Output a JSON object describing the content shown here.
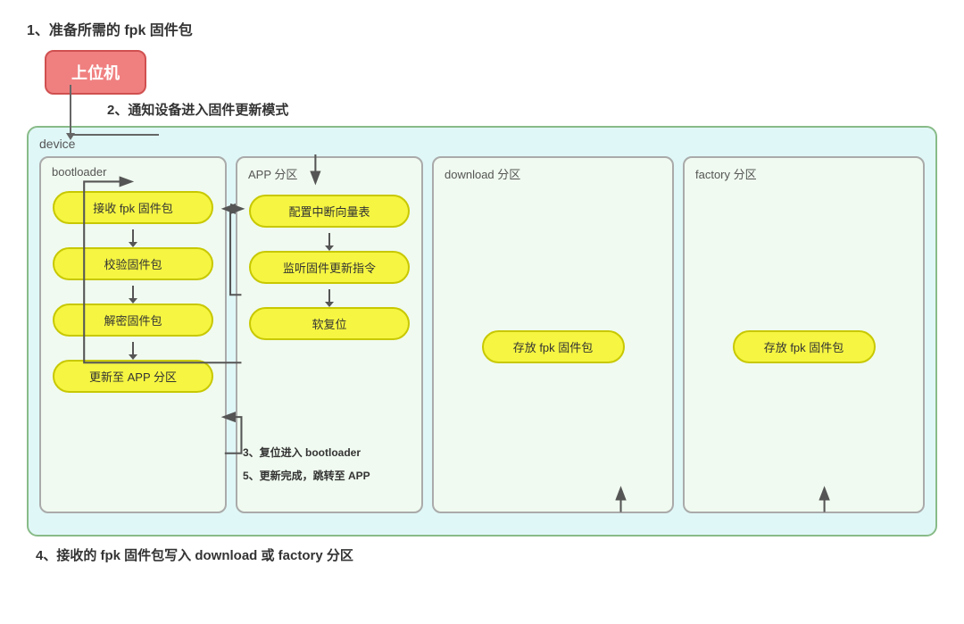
{
  "step1": {
    "label": "1、准备所需的 fpk 固件包"
  },
  "host": {
    "label": "上位机"
  },
  "step2": {
    "label": "2、通知设备进入固件更新模式"
  },
  "device": {
    "label": "device",
    "sections": {
      "bootloader": {
        "title": "bootloader",
        "items": [
          "接收 fpk 固件包",
          "校验固件包",
          "解密固件包",
          "更新至 APP 分区"
        ]
      },
      "app": {
        "title": "APP 分区",
        "items": [
          "配置中断向量表",
          "监听固件更新指令",
          "软复位"
        ]
      },
      "download": {
        "title": "download 分区",
        "item": "存放 fpk 固件包"
      },
      "factory": {
        "title": "factory 分区",
        "item": "存放 fpk 固件包"
      }
    },
    "step3": "3、复位进入 bootloader",
    "step5": "5、更新完成，跳转至 APP"
  },
  "step4": {
    "label": "4、接收的 fpk 固件包写入 download 或 factory 分区"
  }
}
